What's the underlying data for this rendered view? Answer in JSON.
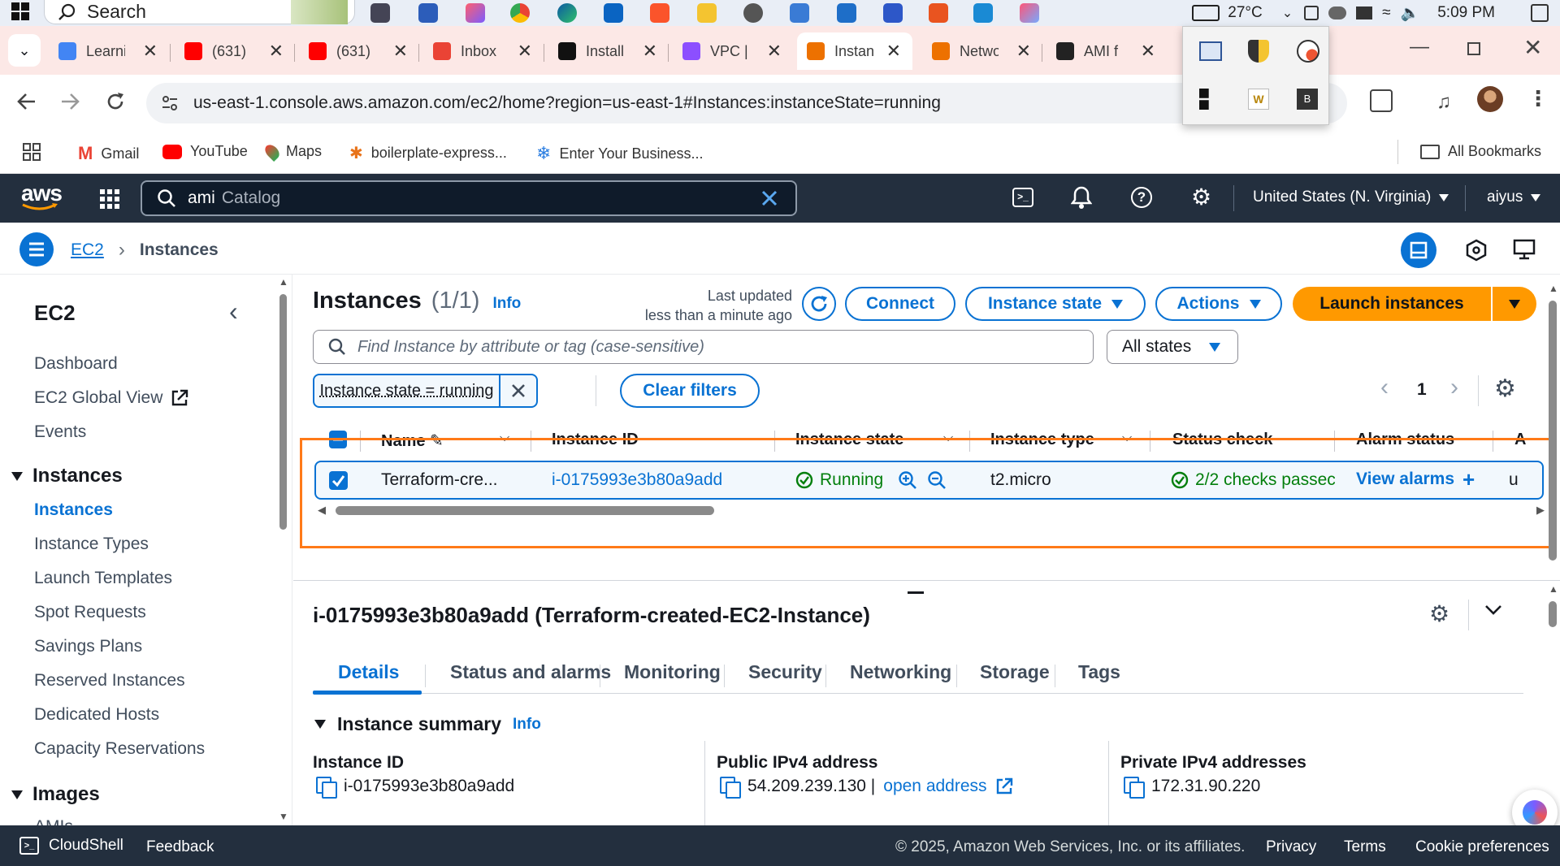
{
  "taskbar": {
    "search_placeholder": "Search",
    "weather": "27°C",
    "time": "5:09 PM"
  },
  "browser": {
    "tabs": [
      {
        "label": "Learni",
        "icon": "chrome-icon"
      },
      {
        "label": "(631)",
        "icon": "youtube-icon"
      },
      {
        "label": "(631)",
        "icon": "youtube-icon"
      },
      {
        "label": "Inbox",
        "icon": "gmail-icon"
      },
      {
        "label": "Install",
        "icon": "hashicorp-icon"
      },
      {
        "label": "VPC |",
        "icon": "vpc-icon"
      },
      {
        "label": "Instan",
        "icon": "aws-ec2-icon",
        "active": true
      },
      {
        "label": "Netwo",
        "icon": "aws-ec2-icon"
      },
      {
        "label": "AMI f",
        "icon": "openai-icon"
      }
    ],
    "url": "us-east-1.console.aws.amazon.com/ec2/home?region=us-east-1#Instances:instanceState=running",
    "bookmarks": [
      "Gmail",
      "YouTube",
      "Maps",
      "boilerplate-express...",
      "Enter Your Business..."
    ],
    "all_bookmarks": "All Bookmarks"
  },
  "aws": {
    "search_value": "ami",
    "search_suffix": "Catalog",
    "region": "United States (N. Virginia)",
    "user": "aiyus",
    "breadcrumb": [
      "EC2",
      "Instances"
    ]
  },
  "sidebar": {
    "title": "EC2",
    "links": [
      "Dashboard",
      "EC2 Global View",
      "Events"
    ],
    "instances_section": "Instances",
    "instances_links": [
      "Instances",
      "Instance Types",
      "Launch Templates",
      "Spot Requests",
      "Savings Plans",
      "Reserved Instances",
      "Dedicated Hosts",
      "Capacity Reservations"
    ],
    "images_section": "Images",
    "images_partial": "AMIs"
  },
  "instances_panel": {
    "title": "Instances",
    "count": "(1/1)",
    "info": "Info",
    "last_updated_1": "Last updated",
    "last_updated_2": "less than a minute ago",
    "connect": "Connect",
    "instance_state": "Instance state",
    "actions": "Actions",
    "launch": "Launch instances",
    "find_placeholder": "Find Instance by attribute or tag (case-sensitive)",
    "states_filter": "All states",
    "filter_token": "Instance state = running",
    "clear_filters": "Clear filters",
    "page": "1",
    "columns": [
      "Name",
      "Instance ID",
      "Instance state",
      "Instance type",
      "Status check",
      "Alarm status",
      "A"
    ],
    "row": {
      "name": "Terraform-cre...",
      "instance_id": "i-0175993e3b80a9add",
      "state": "Running",
      "type": "t2.micro",
      "status_check": "2/2 checks passec",
      "alarm": "View alarms",
      "extra": "u"
    }
  },
  "detail": {
    "title": "i-0175993e3b80a9add (Terraform-created-EC2-Instance)",
    "tabs": [
      "Details",
      "Status and alarms",
      "Monitoring",
      "Security",
      "Networking",
      "Storage",
      "Tags"
    ],
    "summary": "Instance summary",
    "info": "Info",
    "fields": [
      {
        "label": "Instance ID",
        "value": "i-0175993e3b80a9add"
      },
      {
        "label": "Public IPv4 address",
        "value": "54.209.239.130 |",
        "link": "open address"
      },
      {
        "label": "Private IPv4 addresses",
        "value": "172.31.90.220"
      }
    ]
  },
  "footer": {
    "cloudshell": "CloudShell",
    "feedback": "Feedback",
    "copyright": "© 2025, Amazon Web Services, Inc. or its affiliates.",
    "privacy": "Privacy",
    "terms": "Terms",
    "cookies": "Cookie preferences"
  },
  "colors": {
    "aws_nav": "#232f3e",
    "link_blue": "#0972d3",
    "launch_orange": "#ff9900",
    "success_green": "#037f0c",
    "highlight_orange": "#ff7a18"
  }
}
